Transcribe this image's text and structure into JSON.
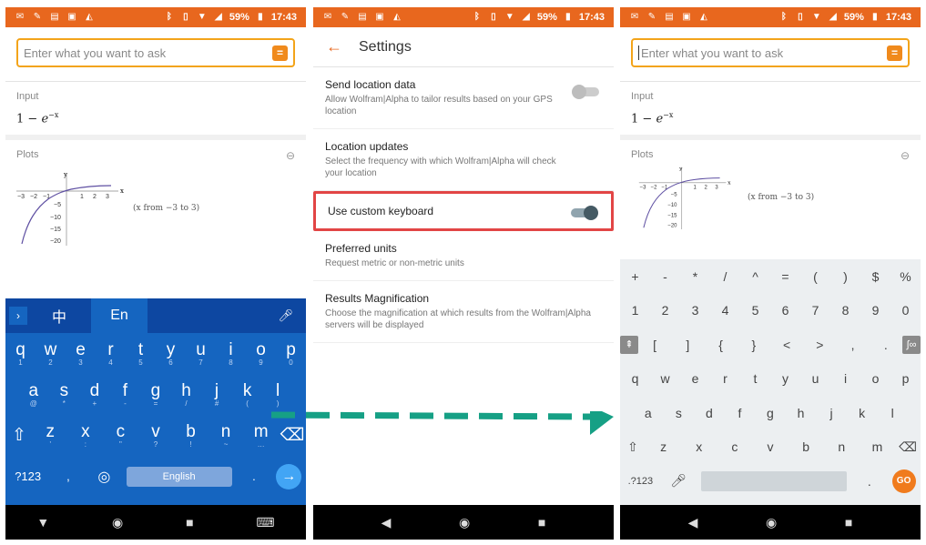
{
  "status": {
    "battery": "59%",
    "time": "17:43"
  },
  "search": {
    "placeholder": "Enter what you want to ask"
  },
  "input_pod": {
    "title": "Input",
    "formula_base": "1 − ",
    "formula_e": "e",
    "formula_exp": "−x"
  },
  "plots_pod": {
    "title": "Plots",
    "note": "(x from −3 to 3)",
    "y": "y",
    "x": "x",
    "xticks": [
      "−3",
      "−2",
      "−1",
      "1",
      "2",
      "3"
    ],
    "yticks": [
      "−5",
      "−10",
      "−15",
      "−20"
    ]
  },
  "gboard": {
    "top": {
      "cn": "中",
      "en": "En"
    },
    "row1": [
      [
        "q",
        "1"
      ],
      [
        "w",
        "2"
      ],
      [
        "e",
        "3"
      ],
      [
        "r",
        "4"
      ],
      [
        "t",
        "5"
      ],
      [
        "y",
        "6"
      ],
      [
        "u",
        "7"
      ],
      [
        "i",
        "8"
      ],
      [
        "o",
        "9"
      ],
      [
        "p",
        "0"
      ]
    ],
    "row2": [
      [
        "a",
        "@"
      ],
      [
        "s",
        "*"
      ],
      [
        "d",
        "+"
      ],
      [
        "f",
        "-"
      ],
      [
        "g",
        "="
      ],
      [
        "h",
        "/"
      ],
      [
        "j",
        "#"
      ],
      [
        "k",
        "("
      ],
      [
        "l",
        ")"
      ]
    ],
    "row3": [
      [
        "z",
        "'"
      ],
      [
        "x",
        ":"
      ],
      [
        "c",
        "\""
      ],
      [
        "v",
        "?"
      ],
      [
        "b",
        "!"
      ],
      [
        "n",
        "~"
      ],
      [
        "m",
        "…"
      ]
    ],
    "sym": "?123",
    "comma": ",",
    "space": "English",
    "period": "."
  },
  "settings": {
    "title": "Settings",
    "items": [
      {
        "title": "Send location data",
        "desc": "Allow Wolfram|Alpha to tailor results based on your GPS location"
      },
      {
        "title": "Location updates",
        "desc": "Select the frequency with which Wolfram|Alpha will check your location"
      },
      {
        "title": "Use custom keyboard",
        "desc": ""
      },
      {
        "title": "Preferred units",
        "desc": "Request metric or non-metric units"
      },
      {
        "title": "Results Magnification",
        "desc": "Choose the magnification at which results from the Wolfram|Alpha servers will be displayed"
      }
    ]
  },
  "mathkb": {
    "row1": [
      "+",
      "-",
      "*",
      "/",
      "^",
      "=",
      "(",
      ")",
      "$",
      "%"
    ],
    "row2": [
      "1",
      "2",
      "3",
      "4",
      "5",
      "6",
      "7",
      "8",
      "9",
      "0"
    ],
    "row3": [
      "[",
      "]",
      "{",
      "}",
      "<",
      ">",
      ",",
      "."
    ],
    "row3_right": "∫∞",
    "row4": [
      "q",
      "w",
      "e",
      "r",
      "t",
      "y",
      "u",
      "i",
      "o",
      "p"
    ],
    "row5": [
      "a",
      "s",
      "d",
      "f",
      "g",
      "h",
      "j",
      "k",
      "l"
    ],
    "row6": [
      "z",
      "x",
      "c",
      "v",
      "b",
      "n",
      "m"
    ],
    "sym": ".?123",
    "go": "GO"
  },
  "colors": {
    "accent": "#e8671e",
    "highlight": "#e24545",
    "arrow": "#16a085"
  }
}
